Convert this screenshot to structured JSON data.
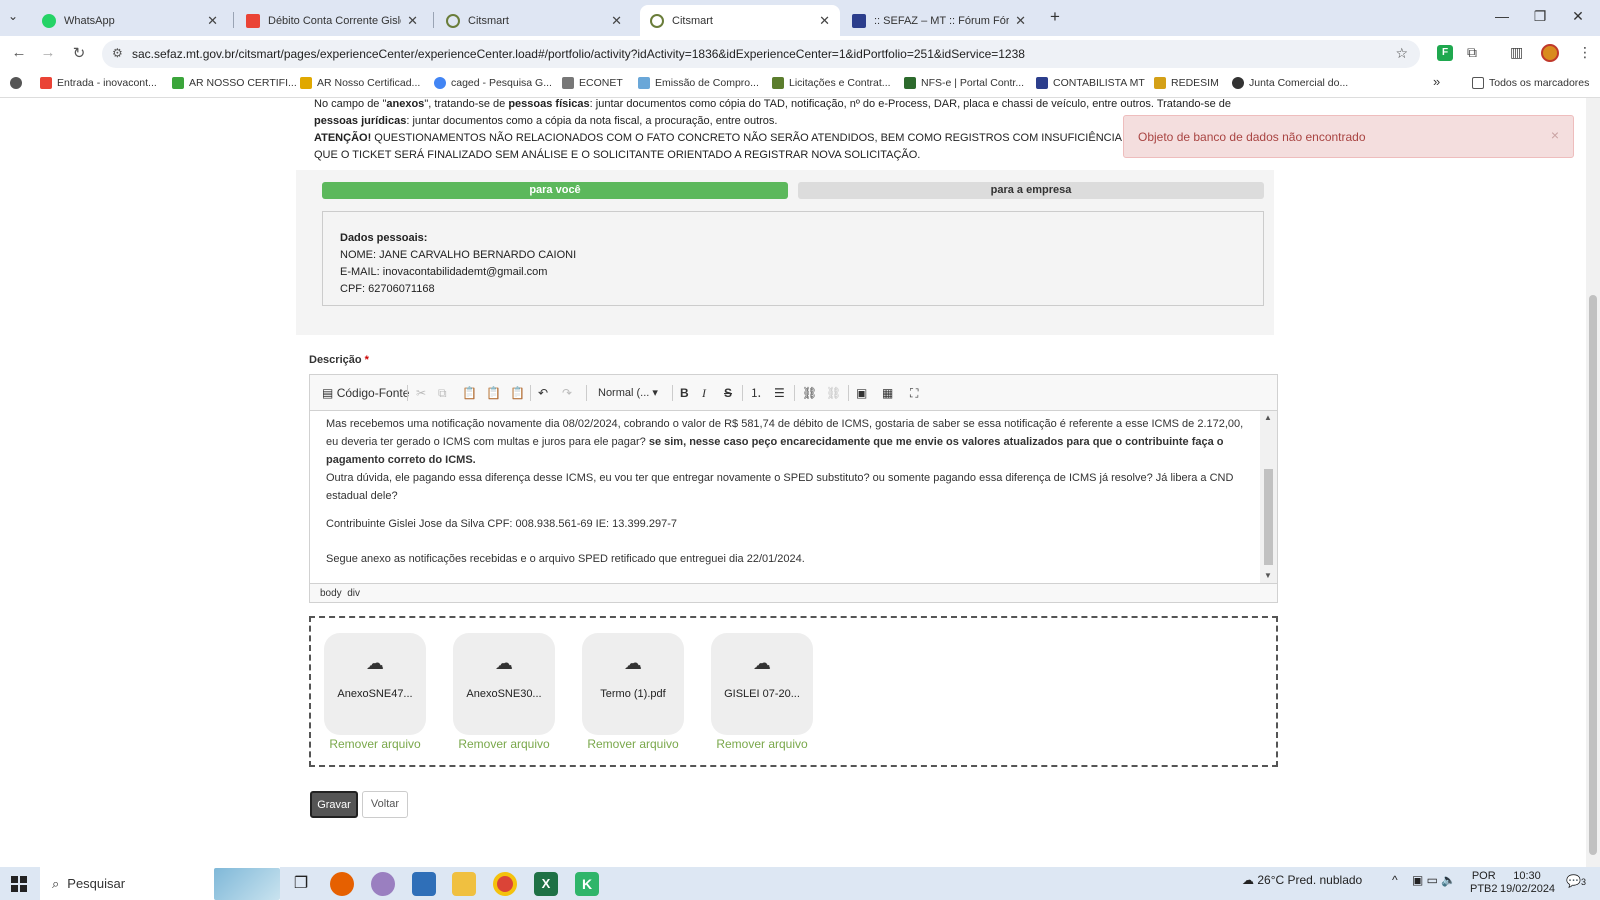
{
  "browser": {
    "tabs": [
      {
        "title": "WhatsApp",
        "color": "#25D366"
      },
      {
        "title": "Débito Conta Corrente Gislei Jo",
        "color": "#EA4335"
      },
      {
        "title": "Citsmart",
        "color": "#6a7d3a"
      },
      {
        "title": "Citsmart",
        "color": "#6a7d3a"
      },
      {
        "title": ":: SEFAZ – MT :: Fórum Fórum",
        "color": "#2c3e8c"
      }
    ],
    "new_tab": "+",
    "url": "sac.sefaz.mt.gov.br/citsmart/pages/experienceCenter/experienceCenter.load#/portfolio/activity?idActivity=1836&idExperienceCenter=1&idPortfolio=251&idService=1238",
    "bookmarks": [
      "Entrada - inovacont...",
      "AR NOSSO CERTIFI...",
      "AR Nosso Certificad...",
      "caged - Pesquisa G...",
      "ECONET",
      "Emissão de Compro...",
      "Licitações e Contrat...",
      "NFS-e | Portal Contr...",
      "CONTABILISTA MT",
      "REDESIM",
      "Junta Comercial do..."
    ],
    "more_bookmarks": "»",
    "all_bookmarks": "Todos os marcadores"
  },
  "info": {
    "line1_prefix": "No campo de \"",
    "line1_bold": "anexos",
    "line1_mid": "\", tratando-se de ",
    "line1_bold2": "pessoas físicas",
    "line1_rest": ": juntar documentos como cópia do TAD, notificação, nº do e-Process, DAR, placa e chassi de veículo, entre outros. Tratando-se de",
    "line2_bold": "pessoas jurídicas",
    "line2_rest": ": juntar documentos como a cópia da nota fiscal, a procuração, entre outros.",
    "line3_bold": "ATENÇÃO!",
    "line3_rest": " QUESTIONAMENTOS NÃO RELACIONADOS COM O FATO CONCRETO NÃO SERÃO ATENDIDOS, BEM COMO REGISTROS COM INSUFICIÊNCIA DE IN",
    "line4": "QUE O TICKET SERÁ FINALIZADO SEM ANÁLISE E O SOLICITANTE ORIENTADO A REGISTRAR NOVA SOLICITAÇÃO."
  },
  "toggles": {
    "personal": "para você",
    "company": "para a empresa"
  },
  "personal_data": {
    "heading": "Dados pessoais:",
    "name": "NOME: JANE CARVALHO BERNARDO CAIONI",
    "email": "E-MAIL: inovacontabilidademt@gmail.com",
    "cpf": "CPF: 62706071168"
  },
  "description": {
    "label": "Descrição",
    "required": "*",
    "toolbar": {
      "source": "Código-Fonte",
      "format": "Normal (..."
    },
    "body": {
      "p1": "Mas recebemos uma notificação novamente dia 08/02/2024, cobrando o valor de R$ 581,74 de débito de ICMS, gostaria de saber se essa notificação é referente a esse ICMS de 2.172,00, eu deveria ter gerado o ICMS com multas e juros para ele pagar? ",
      "p1_bold": " se sim, nesse caso peço encarecidamente que me envie os valores atualizados para que o contribuinte faça o pagamento correto do ICMS.",
      "p2": "Outra dúvida, ele pagando essa diferença desse ICMS, eu vou ter  que entregar novamente o SPED substituto? ou somente pagando essa diferença de ICMS já resolve? Já libera a CND estadual dele?",
      "p3": "Contribuinte Gislei Jose da Silva CPF: 008.938.561-69 IE: 13.399.297-7",
      "p4": "Segue anexo as notificações recebidas e o arquivo SPED  retificado que entreguei dia 22/01/2024."
    },
    "path": [
      "body",
      "div"
    ]
  },
  "attachments": {
    "files": [
      "AnexoSNE47...",
      "AnexoSNE30...",
      "Termo (1).pdf",
      "GISLEI 07-20..."
    ],
    "remove_label": "Remover arquivo"
  },
  "buttons": {
    "save": "Gravar",
    "back": "Voltar"
  },
  "alert": {
    "message": "Objeto de banco de dados não encontrado",
    "close": "×"
  },
  "taskbar": {
    "search_placeholder": "Pesquisar",
    "weather": "26°C  Pred. nublado",
    "lang1": "POR",
    "lang2": "PTB2",
    "time": "10:30",
    "date": "19/02/2024",
    "notifications": "3"
  },
  "colors": {
    "accent_green": "#5cb85c",
    "alert_bg": "#f4dede",
    "remove_link": "#7aa84b"
  }
}
